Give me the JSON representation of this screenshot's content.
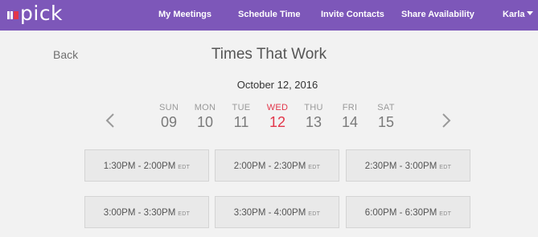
{
  "header": {
    "logo_text": "pick",
    "nav": [
      "My Meetings",
      "Schedule Time",
      "Invite Contacts",
      "Share Availability"
    ],
    "user_name": "Karla"
  },
  "page": {
    "back_label": "Back",
    "title": "Times That Work",
    "date": "October 12, 2016"
  },
  "week": [
    {
      "name": "SUN",
      "num": "09"
    },
    {
      "name": "MON",
      "num": "10"
    },
    {
      "name": "TUE",
      "num": "11"
    },
    {
      "name": "WED",
      "num": "12"
    },
    {
      "name": "THU",
      "num": "13"
    },
    {
      "name": "FRI",
      "num": "14"
    },
    {
      "name": "SAT",
      "num": "15"
    }
  ],
  "selected_day": "WED",
  "slots": [
    {
      "time": "1:30PM - 2:00PM",
      "tz": "EDT"
    },
    {
      "time": "2:00PM - 2:30PM",
      "tz": "EDT"
    },
    {
      "time": "2:30PM - 3:00PM",
      "tz": "EDT"
    },
    {
      "time": "3:00PM - 3:30PM",
      "tz": "EDT"
    },
    {
      "time": "3:30PM - 4:00PM",
      "tz": "EDT"
    },
    {
      "time": "6:00PM - 6:30PM",
      "tz": "EDT"
    }
  ],
  "colors": {
    "header_bg": "#7d57b9",
    "accent": "#e2364a",
    "background": "#f2f2f2"
  }
}
